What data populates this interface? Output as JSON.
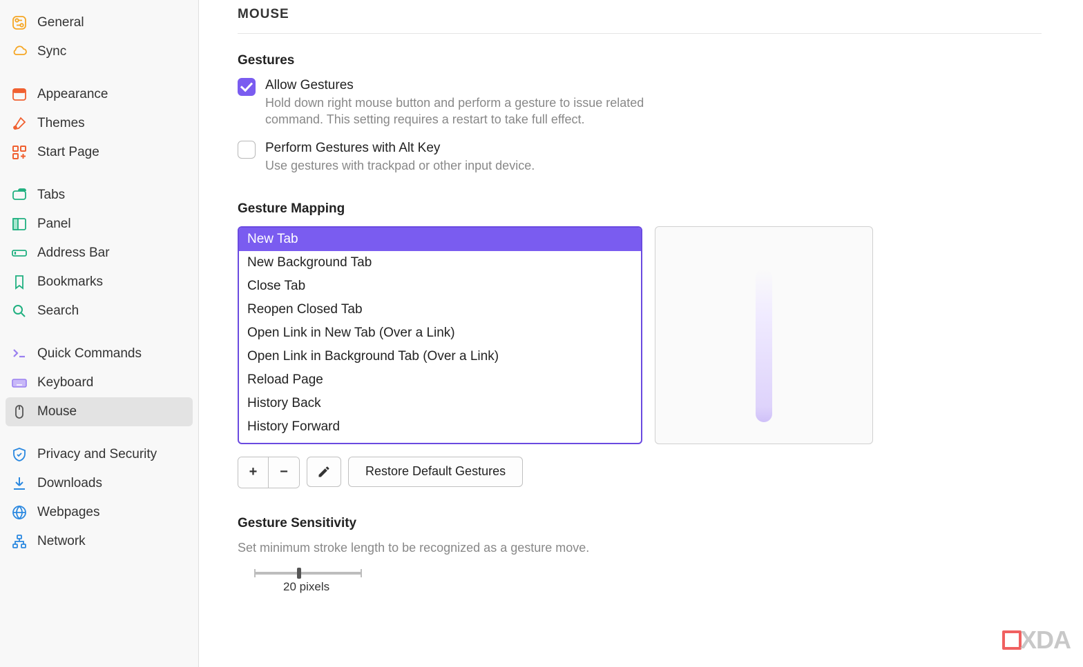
{
  "sidebar": {
    "items": [
      {
        "label": "General"
      },
      {
        "label": "Sync"
      },
      {
        "label": "Appearance"
      },
      {
        "label": "Themes"
      },
      {
        "label": "Start Page"
      },
      {
        "label": "Tabs"
      },
      {
        "label": "Panel"
      },
      {
        "label": "Address Bar"
      },
      {
        "label": "Bookmarks"
      },
      {
        "label": "Search"
      },
      {
        "label": "Quick Commands"
      },
      {
        "label": "Keyboard"
      },
      {
        "label": "Mouse"
      },
      {
        "label": "Privacy and Security"
      },
      {
        "label": "Downloads"
      },
      {
        "label": "Webpages"
      },
      {
        "label": "Network"
      }
    ]
  },
  "page": {
    "title": "MOUSE"
  },
  "gestures": {
    "heading": "Gestures",
    "allow": {
      "label": "Allow Gestures",
      "desc": "Hold down right mouse button and perform a gesture to issue related command. This setting requires a restart to take full effect."
    },
    "altkey": {
      "label": "Perform Gestures with Alt Key",
      "desc": "Use gestures with trackpad or other input device."
    }
  },
  "mapping": {
    "heading": "Gesture Mapping",
    "items": [
      "New Tab",
      "New Background Tab",
      "Close Tab",
      "Reopen Closed Tab",
      "Open Link in New Tab (Over a Link)",
      "Open Link in Background Tab (Over a Link)",
      "Reload Page",
      "History Back",
      "History Forward"
    ],
    "selected": 0,
    "restore_label": "Restore Default Gestures"
  },
  "sensitivity": {
    "heading": "Gesture Sensitivity",
    "desc": "Set minimum stroke length to be recognized as a gesture move.",
    "value_label": "20 pixels"
  },
  "watermark": "XDA"
}
